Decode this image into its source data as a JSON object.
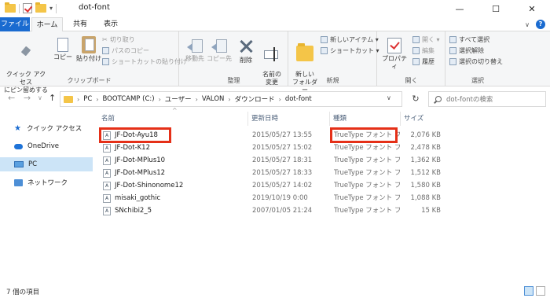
{
  "window": {
    "title": "dot-font",
    "minimize": "—",
    "maximize": "☐",
    "close": "✕"
  },
  "ribbon_tabs": {
    "file": "ファイル",
    "home": "ホーム",
    "share": "共有",
    "view": "表示",
    "expand": "∨",
    "help": "?"
  },
  "ribbon": {
    "clipboard": {
      "label": "クリップボード",
      "pin": "クイック アクセス\nにピン留めする",
      "copy": "コピー",
      "paste": "貼り付け",
      "cut": "切り取り",
      "copy_path": "パスのコピー",
      "paste_shortcut": "ショートカットの貼り付け"
    },
    "organize": {
      "label": "整理",
      "move_to": "移動先",
      "copy_to": "コピー先",
      "delete": "削除",
      "rename": "名前の\n変更"
    },
    "new": {
      "label": "新規",
      "new_folder": "新しい\nフォルダー",
      "new_item": "新しいアイテム ▾",
      "shortcut": "ショートカット ▾"
    },
    "open": {
      "label": "開く",
      "properties": "プロパティ",
      "open": "開く ▾",
      "edit": "編集",
      "history": "履歴"
    },
    "select": {
      "label": "選択",
      "select_all": "すべて選択",
      "select_none": "選択解除",
      "invert": "選択の切り替え"
    }
  },
  "address": {
    "back": "←",
    "forward": "→",
    "recent": "∨",
    "up": "↑",
    "crumbs": [
      "PC",
      "BOOTCAMP (C:)",
      "ユーザー",
      "VALON",
      "ダウンロード",
      "dot-font"
    ],
    "separator": "›",
    "dropdown": "∨",
    "refresh": "↻",
    "search_placeholder": "dot-fontの検索"
  },
  "nav": {
    "items": [
      "クイック アクセス",
      "OneDrive",
      "PC",
      "ネットワーク"
    ],
    "star": "★"
  },
  "list": {
    "headers": [
      "名前",
      "更新日時",
      "種類",
      "サイズ"
    ],
    "sort_caret": "^",
    "file_icon_glyph": "A",
    "rows": [
      {
        "name": "JF-Dot-Ayu18",
        "date": "2015/05/27 13:55",
        "type": "TrueType フォント フ...",
        "size": "2,076 KB"
      },
      {
        "name": "JF-Dot-K12",
        "date": "2015/05/27 15:02",
        "type": "TrueType フォント フ...",
        "size": "2,478 KB"
      },
      {
        "name": "JF-Dot-MPlus10",
        "date": "2015/05/27 18:31",
        "type": "TrueType フォント フ...",
        "size": "1,362 KB"
      },
      {
        "name": "JF-Dot-MPlus12",
        "date": "2015/05/27 18:33",
        "type": "TrueType フォント フ...",
        "size": "1,512 KB"
      },
      {
        "name": "JF-Dot-Shinonome12",
        "date": "2015/05/27 14:02",
        "type": "TrueType フォント フ...",
        "size": "1,580 KB"
      },
      {
        "name": "misaki_gothic",
        "date": "2019/10/19 0:00",
        "type": "TrueType フォント フ...",
        "size": "1,088 KB"
      },
      {
        "name": "SNchibi2_5",
        "date": "2007/01/05 21:24",
        "type": "TrueType フォント フ...",
        "size": "15 KB"
      }
    ]
  },
  "status": {
    "item_count": "7 個の項目"
  }
}
